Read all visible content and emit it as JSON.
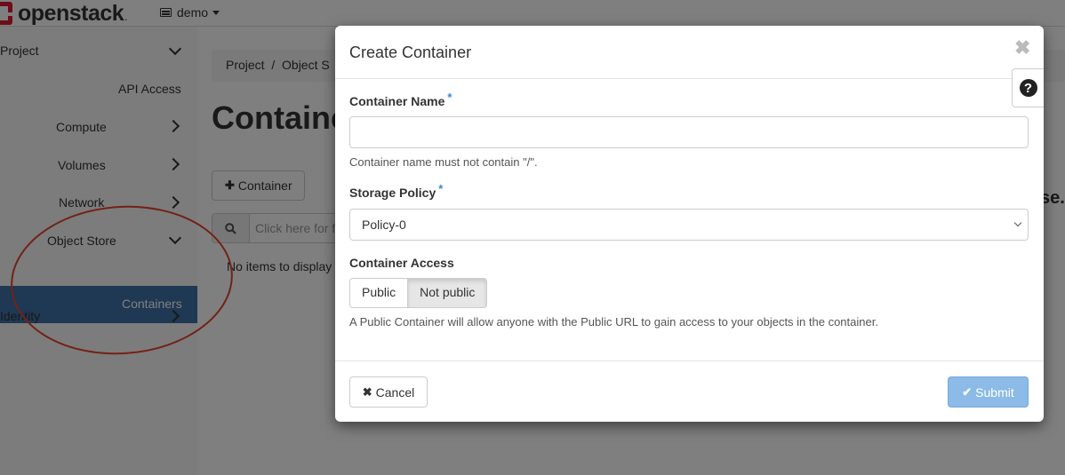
{
  "topbar": {
    "logo_text": "openstack",
    "logo_dot": ".",
    "project_name": "demo"
  },
  "sidebar": {
    "items": [
      {
        "label": "Project",
        "chevron": "down"
      },
      {
        "label": "API Access"
      },
      {
        "label": "Compute",
        "chevron": "right"
      },
      {
        "label": "Volumes",
        "chevron": "right"
      },
      {
        "label": "Network",
        "chevron": "right"
      },
      {
        "label": "Object Store",
        "chevron": "down"
      },
      {
        "label": "Containers",
        "active": true
      },
      {
        "label": "Identity",
        "chevron": "right"
      }
    ]
  },
  "main": {
    "breadcrumb": "Project  /  Object S",
    "title": "Containe",
    "add_button": "Container",
    "search_placeholder": "Click here for f",
    "no_items": "No items to display",
    "right_fragment": "se."
  },
  "modal": {
    "title": "Create Container",
    "close_glyph": "✖",
    "help_glyph": "?",
    "container_name": {
      "label": "Container Name",
      "required_mark": "*",
      "value": "",
      "help": "Container name must not contain \"/\"."
    },
    "storage_policy": {
      "label": "Storage Policy",
      "required_mark": "*",
      "selected": "Policy-0"
    },
    "container_access": {
      "label": "Container Access",
      "options": [
        "Public",
        "Not public"
      ],
      "selected": "Not public",
      "help": "A Public Container will allow anyone with the Public URL to gain access to your objects in the container."
    },
    "cancel_label": "Cancel",
    "submit_label": "Submit"
  },
  "colors": {
    "sidebar_active": "#3f70a7",
    "submit_disabled": "#8bbbe6",
    "annotation_circle": "#e8432d",
    "required": "#3a87c8"
  }
}
